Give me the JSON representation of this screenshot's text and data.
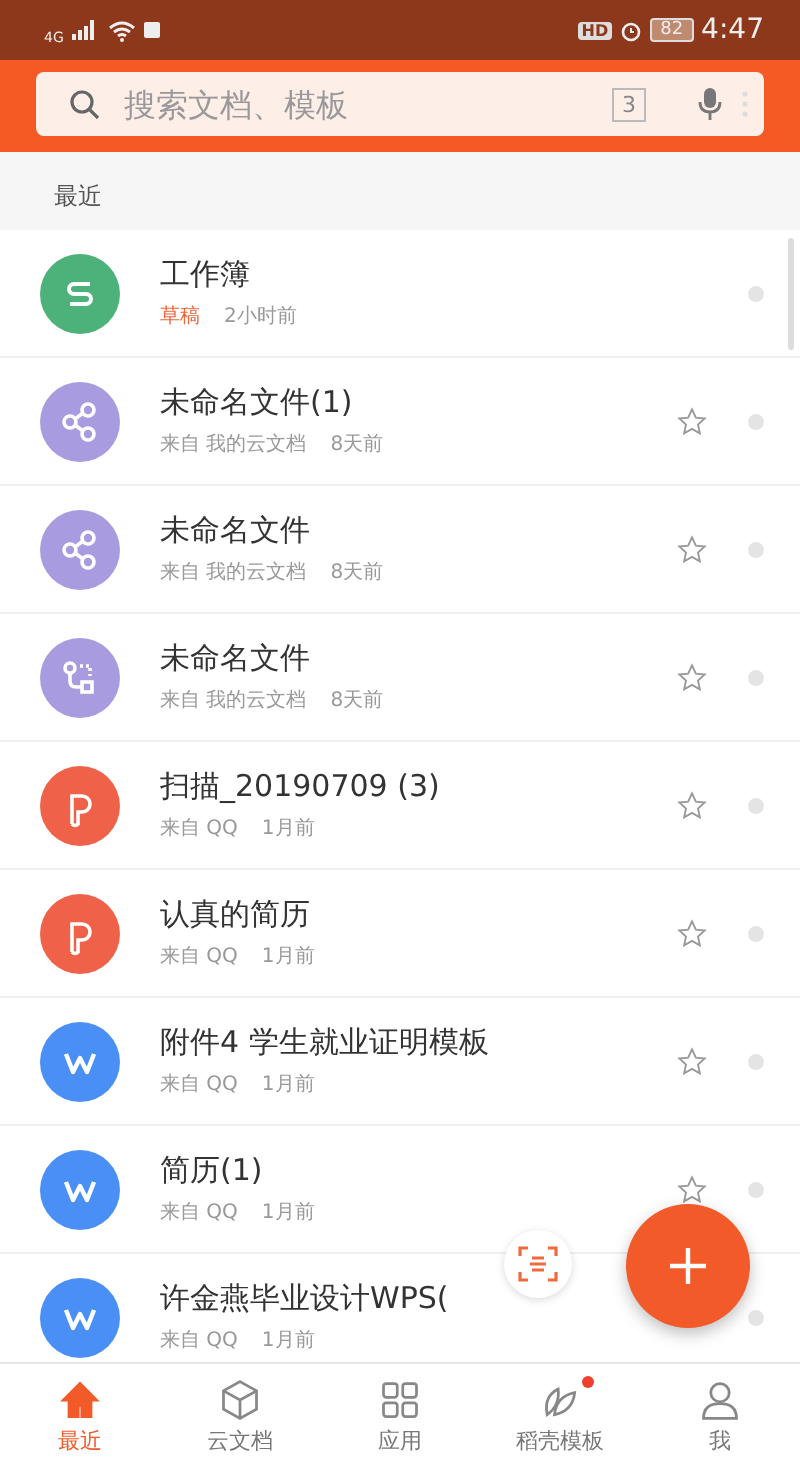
{
  "status_bar": {
    "network": "4G",
    "hd": "HD",
    "battery": "82",
    "time": "4:47"
  },
  "search": {
    "placeholder": "搜索文档、模板",
    "tab_count": "3"
  },
  "section_title": "最近",
  "files": [
    {
      "name": "工作簿",
      "kind": "sheet",
      "color": "#4cb27a",
      "tag": "草稿",
      "time": "2小时前",
      "starrable": false
    },
    {
      "name": "未命名文件(1)",
      "kind": "share",
      "color": "#a99be0",
      "source": "来自 我的云文档",
      "time": "8天前",
      "starrable": true,
      "starred": false
    },
    {
      "name": "未命名文件",
      "kind": "share",
      "color": "#a99be0",
      "source": "来自 我的云文档",
      "time": "8天前",
      "starrable": true,
      "starred": false
    },
    {
      "name": "未命名文件",
      "kind": "flow",
      "color": "#a99be0",
      "source": "来自 我的云文档",
      "time": "8天前",
      "starrable": true,
      "starred": false
    },
    {
      "name": "扫描_20190709 (3)",
      "kind": "pdf",
      "color": "#f0614a",
      "source": "来自 QQ",
      "time": "1月前",
      "starrable": true,
      "starred": false
    },
    {
      "name": "认真的简历",
      "kind": "pdf",
      "color": "#f0614a",
      "source": "来自 QQ",
      "time": "1月前",
      "starrable": true,
      "starred": false
    },
    {
      "name": "附件4 学生就业证明模板",
      "kind": "writer",
      "color": "#4a8ff5",
      "source": "来自 QQ",
      "time": "1月前",
      "starrable": true,
      "starred": false
    },
    {
      "name": "简历(1)",
      "kind": "writer",
      "color": "#4a8ff5",
      "source": "来自 QQ",
      "time": "1月前",
      "starrable": true,
      "starred": false
    },
    {
      "name": "许金燕毕业设计WPS(",
      "kind": "writer",
      "color": "#4a8ff5",
      "source": "来自 QQ",
      "time": "1月前",
      "starrable": false
    }
  ],
  "tabs": [
    {
      "label": "最近",
      "kind": "home",
      "selected": true,
      "badge": false
    },
    {
      "label": "云文档",
      "kind": "cube",
      "selected": false,
      "badge": false
    },
    {
      "label": "应用",
      "kind": "grid",
      "selected": false,
      "badge": false
    },
    {
      "label": "稻壳模板",
      "kind": "leaf",
      "selected": false,
      "badge": true
    },
    {
      "label": "我",
      "kind": "person",
      "selected": false,
      "badge": false
    }
  ]
}
